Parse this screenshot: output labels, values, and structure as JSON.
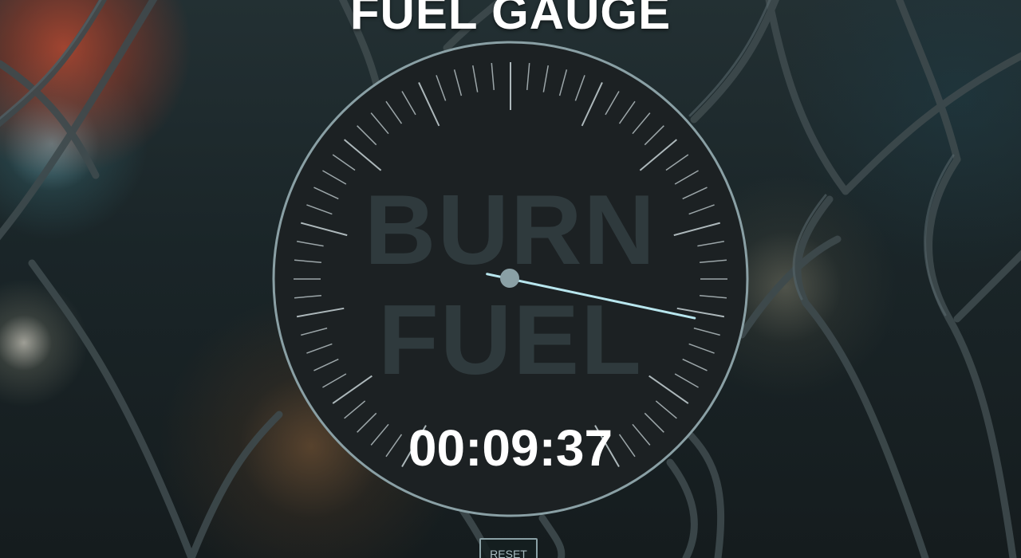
{
  "title": "FUEL GAUGE",
  "gauge": {
    "watermark_line1": "BURN",
    "watermark_line2": "FUEL",
    "timer": "00:09:37",
    "fuel_level": 0.84
  },
  "controls": {
    "reset_label": "RESET"
  },
  "colors": {
    "gauge_face": "#1c2123",
    "gauge_rim": "#8aa0a5",
    "needle": "#b8e6ee",
    "ticks": "#c7d3d6",
    "watermark": "#2f3a3d"
  },
  "icons": {
    "needle_hub": "needle-hub-icon"
  }
}
